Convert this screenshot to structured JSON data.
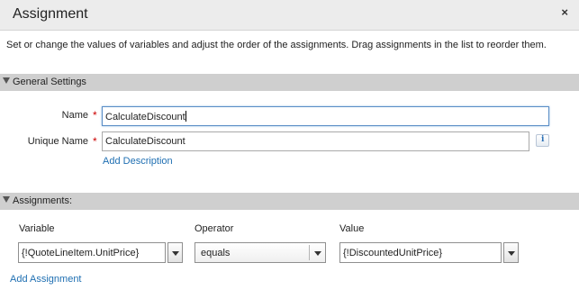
{
  "dialog": {
    "title": "Assignment",
    "close_label": "×",
    "description": "Set or change the values of variables and adjust the order of the assignments. Drag assignments in the list to reorder them."
  },
  "general_settings": {
    "header": "General Settings",
    "name_label": "Name",
    "name_value": "CalculateDiscount",
    "unique_name_label": "Unique Name",
    "unique_name_value": "CalculateDiscount",
    "required_marker": "*",
    "info_label": "i",
    "add_description": "Add Description"
  },
  "assignments": {
    "header": "Assignments:",
    "columns": {
      "variable": "Variable",
      "operator": "Operator",
      "value": "Value"
    },
    "rows": [
      {
        "variable": "{!QuoteLineItem.UnitPrice}",
        "operator": "equals",
        "value": "{!DiscountedUnitPrice}"
      }
    ],
    "add_assignment": "Add Assignment"
  }
}
